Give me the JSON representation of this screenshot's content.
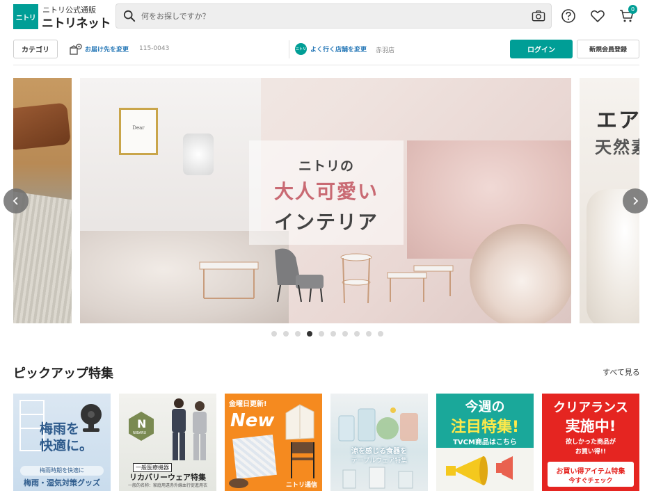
{
  "header": {
    "logo_mark": "ニトリ",
    "logo_sub": "ニトリ公式通販",
    "logo_main": "ニトリネット",
    "search_placeholder": "何をお探しですか？",
    "cart_count": "0"
  },
  "subheader": {
    "category_label": "カテゴリ",
    "delivery_link": "お届け先を変更",
    "delivery_zip": "115-0043",
    "store_badge": "ニトリ",
    "store_link": "よく行く店舗を変更",
    "store_name": "赤羽店",
    "login_label": "ログイン",
    "register_label": "新規会員登録"
  },
  "carousel": {
    "main_line1": "ニトリの",
    "main_line2": "大人可愛い",
    "main_line3": "インテリア",
    "right_line1": "エア",
    "right_line2": "天然素",
    "frame_text": "Dear",
    "dot_count": 10,
    "active_index": 3
  },
  "pickup": {
    "title": "ピックアップ特集",
    "see_all": "すべて見る",
    "cards": [
      {
        "lines": [
          "梅雨を",
          "快適に。"
        ],
        "tag": "梅雨時期を快適に",
        "caption": "梅雨・湿気対策グッズ"
      },
      {
        "badge": "N",
        "badge_sub": "NIBARU",
        "tag": "一般医療機器",
        "caption": "リカバリーウェア特集",
        "fine": "一般的名称：家庭用遠赤外線血行促進用衣"
      },
      {
        "tag": "金曜日更新!",
        "headline": "New",
        "footer": "ニトリ通信"
      },
      {
        "caption1": "涼を感じる食器を",
        "caption2": "テーブルウェア特集"
      },
      {
        "line1": "今週の",
        "line2": "注目特集!",
        "line3": "TVCM商品はこちら"
      },
      {
        "line1": "クリアランス",
        "line2": "実施中!",
        "line3": "欲しかった商品が",
        "line4": "お買い得!!",
        "line5": "お買い得アイテム特集",
        "line6": "今すぐチェック"
      }
    ]
  },
  "colors": {
    "brand": "#009e96",
    "link": "#2a7ab8",
    "accent_pink": "#c96a73",
    "clearance_red": "#e52521",
    "new_orange": "#f58a1f"
  }
}
